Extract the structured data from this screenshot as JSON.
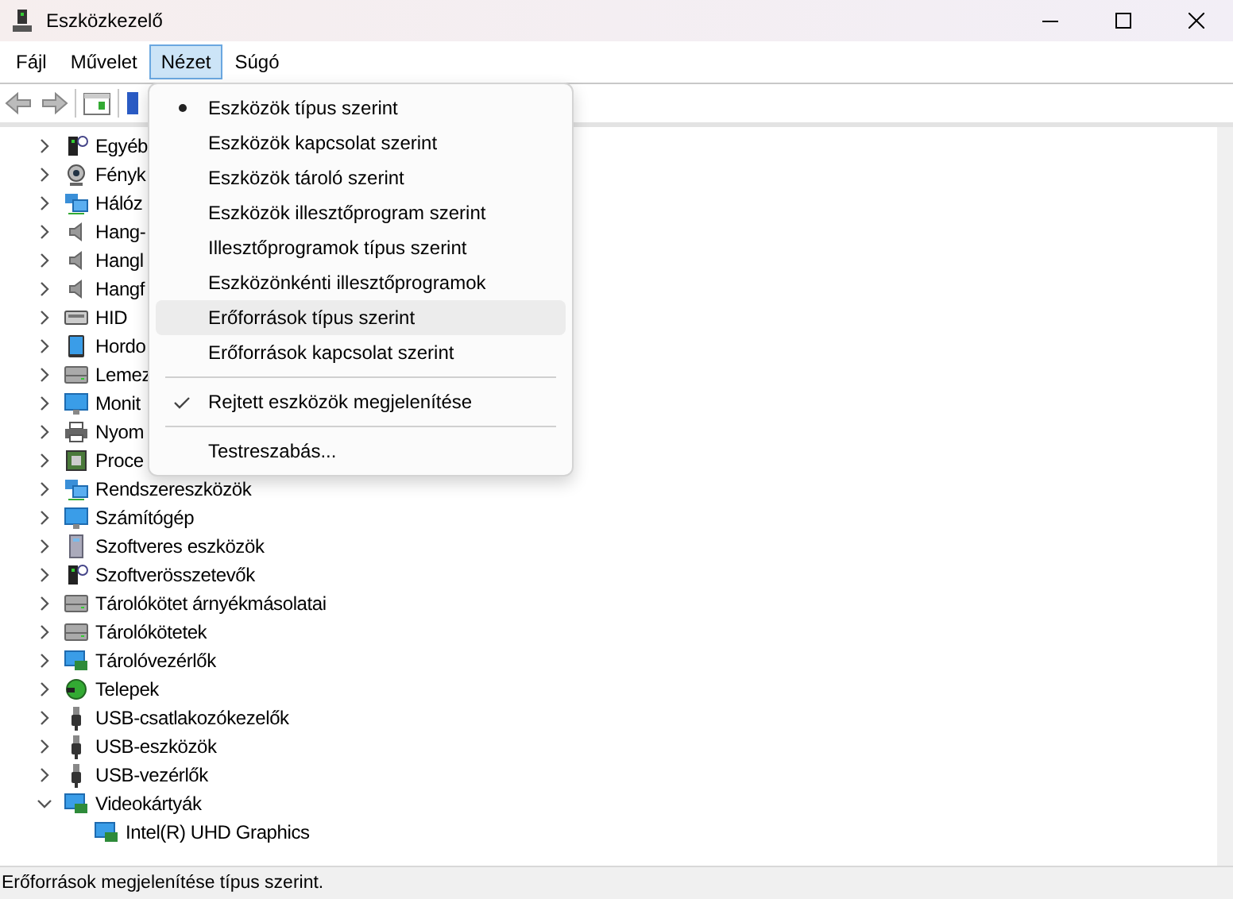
{
  "window": {
    "title": "Eszközkezelő"
  },
  "menu_bar": [
    {
      "label": "Fájl",
      "selected": false
    },
    {
      "label": "Művelet",
      "selected": false
    },
    {
      "label": "Nézet",
      "selected": true
    },
    {
      "label": "Súgó",
      "selected": false
    }
  ],
  "view_menu": [
    {
      "label": "Eszközök típus szerint",
      "kind": "radio",
      "selected": true,
      "highlighted": false
    },
    {
      "label": "Eszközök kapcsolat szerint",
      "kind": "radio",
      "selected": false,
      "highlighted": false
    },
    {
      "label": "Eszközök tároló szerint",
      "kind": "radio",
      "selected": false,
      "highlighted": false
    },
    {
      "label": "Eszközök illesztőprogram szerint",
      "kind": "radio",
      "selected": false,
      "highlighted": false
    },
    {
      "label": "Illesztőprogramok típus szerint",
      "kind": "radio",
      "selected": false,
      "highlighted": false
    },
    {
      "label": "Eszközönkénti illesztőprogramok",
      "kind": "radio",
      "selected": false,
      "highlighted": false
    },
    {
      "label": "Erőforrások típus szerint",
      "kind": "radio",
      "selected": false,
      "highlighted": true
    },
    {
      "label": "Erőforrások kapcsolat szerint",
      "kind": "radio",
      "selected": false,
      "highlighted": false
    },
    {
      "kind": "separator"
    },
    {
      "label": "Rejtett eszközök megjelenítése",
      "kind": "check",
      "checked": true,
      "highlighted": false
    },
    {
      "kind": "separator"
    },
    {
      "label": "Testreszabás...",
      "kind": "plain",
      "highlighted": false
    }
  ],
  "tree": [
    {
      "label": "Egyéb",
      "kind": "unknown",
      "expanded": false
    },
    {
      "label": "Fényk",
      "kind": "camera",
      "expanded": false
    },
    {
      "label": "Hálóz",
      "kind": "network",
      "expanded": false
    },
    {
      "label": "Hang-",
      "kind": "speaker",
      "expanded": false
    },
    {
      "label": "Hangl",
      "kind": "speaker",
      "expanded": false
    },
    {
      "label": "Hangf",
      "kind": "speaker",
      "expanded": false
    },
    {
      "label": "HID",
      "kind": "keyboard",
      "expanded": false
    },
    {
      "label": "Hordo",
      "kind": "tablet",
      "expanded": false
    },
    {
      "label": "Lemez",
      "kind": "drive",
      "expanded": false
    },
    {
      "label": "Monit",
      "kind": "monitor",
      "expanded": false
    },
    {
      "label": "Nyom",
      "kind": "printer",
      "expanded": false
    },
    {
      "label": "Proce",
      "kind": "chip",
      "expanded": false
    },
    {
      "label": "Rendszereszközök",
      "kind": "network",
      "expanded": false
    },
    {
      "label": "Számítógép",
      "kind": "monitor",
      "expanded": false
    },
    {
      "label": "Szoftveres eszközök",
      "kind": "tower",
      "expanded": false
    },
    {
      "label": "Szoftverösszetevők",
      "kind": "unknown",
      "expanded": false
    },
    {
      "label": "Tárolókötet árnyékmásolatai",
      "kind": "drive",
      "expanded": false
    },
    {
      "label": "Tárolókötetek",
      "kind": "drive",
      "expanded": false
    },
    {
      "label": "Tárolóvezérlők",
      "kind": "card",
      "expanded": false
    },
    {
      "label": "Telepek",
      "kind": "battery",
      "expanded": false
    },
    {
      "label": "USB-csatlakozókezelők",
      "kind": "usb",
      "expanded": false
    },
    {
      "label": "USB-eszközök",
      "kind": "usb",
      "expanded": false
    },
    {
      "label": "USB-vezérlők",
      "kind": "usb",
      "expanded": false
    },
    {
      "label": "Videokártyák",
      "kind": "card",
      "expanded": true,
      "children": [
        {
          "label": "Intel(R) UHD Graphics",
          "kind": "card"
        }
      ]
    }
  ],
  "status_bar": "Erőforrások megjelenítése típus szerint."
}
